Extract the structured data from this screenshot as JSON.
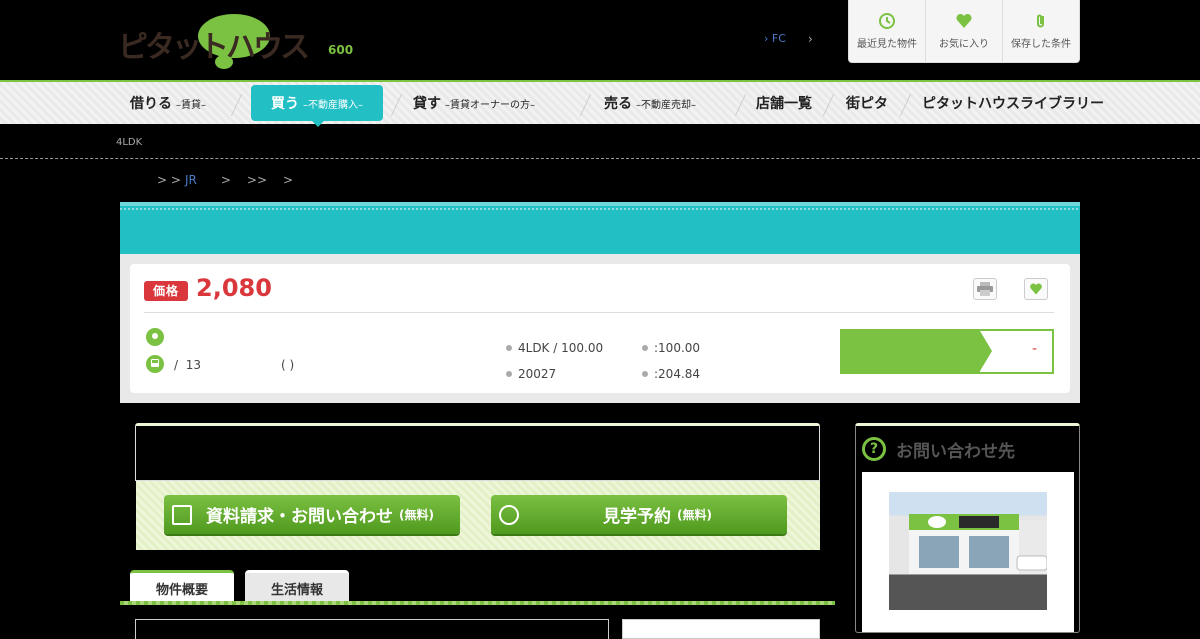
{
  "header": {
    "logo_text": "ピタットハウス",
    "top_number": "600",
    "fc_label": "FC",
    "quick_links": [
      {
        "label": "最近見た物件",
        "icon": "clock-icon"
      },
      {
        "label": "お気に入り",
        "icon": "heart-icon"
      },
      {
        "label": "保存した条件",
        "icon": "paperclip-icon"
      }
    ]
  },
  "nav": {
    "items": [
      {
        "label": "借りる",
        "sub": "–賃貸–"
      },
      {
        "label": "買う",
        "sub": "–不動産購入–"
      },
      {
        "label": "貸す",
        "sub": "–賃貸オーナーの方–"
      },
      {
        "label": "売る",
        "sub": "–不動産売却–"
      },
      {
        "label": "店舗一覧",
        "sub": ""
      },
      {
        "label": "街ピタ",
        "sub": ""
      },
      {
        "label": "ピタットハウスライブラリー",
        "sub": ""
      }
    ]
  },
  "page": {
    "sub_text": "4LDK",
    "breadcrumb": {
      "prefix": "> >",
      "link": "JR",
      "sep1": ">",
      "sep2": ">>",
      "sep3": ">"
    }
  },
  "property": {
    "price_tag": "価格",
    "price": "2,080",
    "access_sep": "/",
    "access_minutes": "13",
    "access_paren": "( )",
    "specs": {
      "layout": "4LDK / 100.00",
      "building_area": ":100.00",
      "built": "20027",
      "land_area": ":204.84"
    },
    "cta_dash": "-"
  },
  "contact": {
    "request_label": "資料請求・お問い合わせ",
    "request_free": "(無料)",
    "visit_label": "見学予約",
    "visit_free": "(無料)"
  },
  "tabs": [
    {
      "label": "物件概要"
    },
    {
      "label": "生活情報"
    }
  ],
  "sidebar": {
    "title": "お問い合わせ先"
  },
  "colors": {
    "accent_green": "#7bc142",
    "teal": "#22bfc4",
    "price_red": "#d9373b"
  }
}
